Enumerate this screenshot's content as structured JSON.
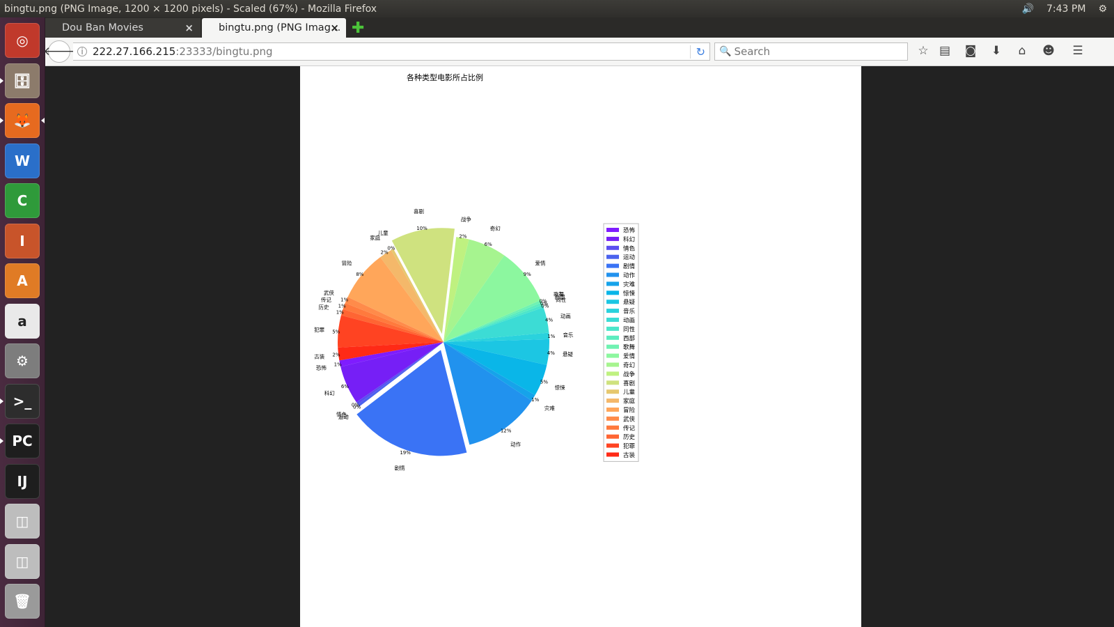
{
  "window": {
    "title": "bingtu.png (PNG Image, 1200 × 1200 pixels) - Scaled (67%) - Mozilla Firefox",
    "volume_icon": "🔊",
    "clock": "7:43 PM",
    "gear_icon": "⚙"
  },
  "launcher": {
    "items": [
      {
        "name": "ubuntu-dash",
        "glyph": "◎",
        "bg": "#c0392b"
      },
      {
        "name": "files",
        "glyph": "🗄",
        "bg": "#8c7b6b"
      },
      {
        "name": "firefox",
        "glyph": "🦊",
        "bg": "#e66a1f"
      },
      {
        "name": "libreoffice-writer",
        "glyph": "W",
        "bg": "#2a6fc9"
      },
      {
        "name": "libreoffice-calc",
        "glyph": "C",
        "bg": "#2f9a3a"
      },
      {
        "name": "libreoffice-impress",
        "glyph": "I",
        "bg": "#c8542a"
      },
      {
        "name": "software-center",
        "glyph": "A",
        "bg": "#e07b25"
      },
      {
        "name": "amazon",
        "glyph": "a",
        "bg": "#e9e9e9"
      },
      {
        "name": "system-settings",
        "glyph": "⚙",
        "bg": "#7d7d7d"
      },
      {
        "name": "terminal",
        "glyph": ">_",
        "bg": "#2d2d2d"
      },
      {
        "name": "pycharm",
        "glyph": "PC",
        "bg": "#1e1e1e"
      },
      {
        "name": "intellij",
        "glyph": "IJ",
        "bg": "#1e1e1e"
      },
      {
        "name": "disk-1",
        "glyph": "◫",
        "bg": "#bdbdbd"
      },
      {
        "name": "disk-2",
        "glyph": "◫",
        "bg": "#bdbdbd"
      },
      {
        "name": "trash",
        "glyph": "🗑",
        "bg": "#9a9a9a"
      }
    ]
  },
  "browser": {
    "tabs": [
      {
        "label": "Dou Ban Movies",
        "close": "×"
      },
      {
        "label": "bingtu.png (PNG Imag…",
        "close": "×"
      }
    ],
    "new_tab": "✚",
    "back": "🡐",
    "url_host": "222.27.166.215",
    "url_rest": ":23333/bingtu.png",
    "reload": "↻",
    "search_placeholder": "Search",
    "search_icon": "🔍",
    "toolbar_icons": [
      "☆",
      "▤",
      "◙",
      "⬇",
      "⌂",
      "☻",
      "☰"
    ]
  },
  "chart_data": {
    "type": "pie",
    "title": "各种类型电影所占比例",
    "legend_position": "right",
    "explode": [
      "喜剧",
      "剧情"
    ],
    "slices": [
      {
        "label": "恐怖",
        "value": 1,
        "pct": "1%",
        "color": "#7f1cff"
      },
      {
        "label": "科幻",
        "value": 6,
        "pct": "6%",
        "color": "#761ff6"
      },
      {
        "label": "情色",
        "value": 0.4,
        "pct": "0%",
        "color": "#5b4ff0"
      },
      {
        "label": "运动",
        "value": 0.4,
        "pct": "0%",
        "color": "#4b62ee"
      },
      {
        "label": "剧情",
        "value": 19,
        "pct": "19%",
        "color": "#3a73f5"
      },
      {
        "label": "动作",
        "value": 12,
        "pct": "12%",
        "color": "#2192ee"
      },
      {
        "label": "灾难",
        "value": 1,
        "pct": "1%",
        "color": "#16a3ea"
      },
      {
        "label": "惊悚",
        "value": 5,
        "pct": "5%",
        "color": "#0ab6e8"
      },
      {
        "label": "悬疑",
        "value": 4,
        "pct": "4%",
        "color": "#1cc6e3"
      },
      {
        "label": "音乐",
        "value": 1,
        "pct": "1%",
        "color": "#2ad2dd"
      },
      {
        "label": "动画",
        "value": 4,
        "pct": "4%",
        "color": "#3cdcd5"
      },
      {
        "label": "同性",
        "value": 0.4,
        "pct": "0%",
        "color": "#4ce6ca"
      },
      {
        "label": "西部",
        "value": 0.4,
        "pct": "0%",
        "color": "#5cecbf"
      },
      {
        "label": "歌舞",
        "value": 0.4,
        "pct": "0%",
        "color": "#6ff2b2"
      },
      {
        "label": "爱情",
        "value": 9,
        "pct": "9%",
        "color": "#8cf79f"
      },
      {
        "label": "奇幻",
        "value": 6,
        "pct": "6%",
        "color": "#a6f48f"
      },
      {
        "label": "战争",
        "value": 2,
        "pct": "2%",
        "color": "#bff180"
      },
      {
        "label": "喜剧",
        "value": 10,
        "pct": "10%",
        "color": "#cfe27f"
      },
      {
        "label": "儿童",
        "value": 0.4,
        "pct": "0%",
        "color": "#e6c86f"
      },
      {
        "label": "家庭",
        "value": 2,
        "pct": "2%",
        "color": "#f4b86a"
      },
      {
        "label": "冒险",
        "value": 8,
        "pct": "8%",
        "color": "#ffa65a"
      },
      {
        "label": "武侠",
        "value": 1,
        "pct": "1%",
        "color": "#ff8b4a"
      },
      {
        "label": "传记",
        "value": 1,
        "pct": "1%",
        "color": "#ff7a3d"
      },
      {
        "label": "历史",
        "value": 1,
        "pct": "1%",
        "color": "#ff6533"
      },
      {
        "label": "犯罪",
        "value": 5,
        "pct": "5%",
        "color": "#ff4322"
      },
      {
        "label": "古装",
        "value": 2,
        "pct": "2%",
        "color": "#ff2a16"
      }
    ]
  }
}
